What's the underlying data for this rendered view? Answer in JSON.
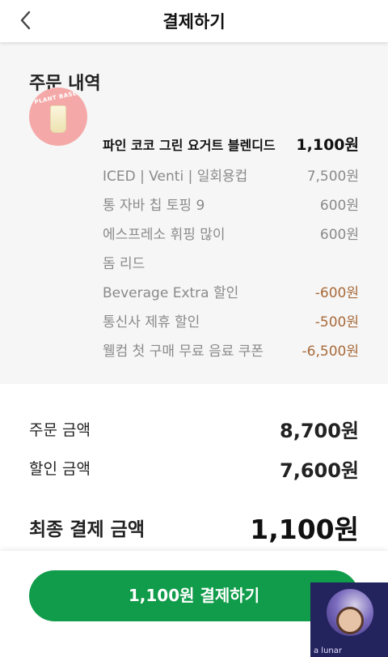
{
  "header": {
    "title": "결제하기",
    "back_icon": "chevron-left-icon"
  },
  "order": {
    "section_title": "주문 내역",
    "product": {
      "image_badge": "PLANT BASED",
      "name": "파인 코코 그린 요거트 블렌디드",
      "price": "1,100원"
    },
    "options": [
      {
        "label": "ICED | Venti | 일회용컵",
        "value": "7,500원"
      },
      {
        "label": "통 자바 칩 토핑 9",
        "value": "600원"
      },
      {
        "label": "에스프레소 휘핑 많이",
        "value": "600원"
      },
      {
        "label": "돔 리드",
        "value": ""
      },
      {
        "label": "Beverage Extra 할인",
        "value": "-600원"
      },
      {
        "label": "통신사 제휴 할인",
        "value": "-500원"
      },
      {
        "label": "웰컴 첫 구매 무료 음료 쿠폰",
        "value": "-6,500원"
      }
    ]
  },
  "summary": {
    "order_amount_label": "주문 금액",
    "order_amount_value": "8,700원",
    "discount_label": "할인 금액",
    "discount_value": "7,600원",
    "final_label": "최종 결제 금액",
    "final_value": "1,100원"
  },
  "pay_button": {
    "label": "1,100원 결제하기"
  },
  "watermark": {
    "text": "a lunar"
  },
  "colors": {
    "accent": "#109c4a",
    "discount": "#a86a3a",
    "section_bg": "#f6f6f6"
  }
}
